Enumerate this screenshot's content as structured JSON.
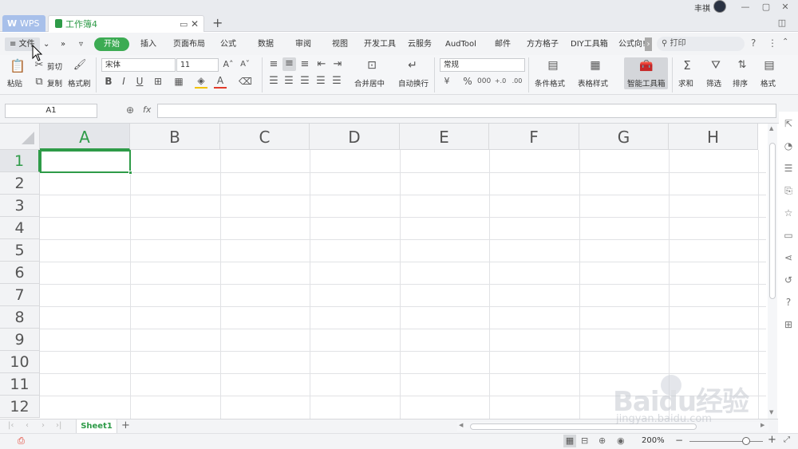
{
  "titlebar": {
    "user_name": "丰祺",
    "tabs": [
      {
        "label": "WPS"
      },
      {
        "label": "工作簿4"
      }
    ],
    "new_tab": "+"
  },
  "menubar": {
    "file_label": "文件",
    "items": [
      "开始",
      "插入",
      "页面布局",
      "公式",
      "数据",
      "审阅",
      "视图",
      "开发工具",
      "云服务",
      "AudTool",
      "邮件",
      "方方格子",
      "DIY工具箱",
      "公式向!"
    ],
    "search_placeholder": "打印",
    "help": "?"
  },
  "ribbon": {
    "paste": "粘贴",
    "cut": "剪切",
    "copy": "复制",
    "format_painter": "格式刷",
    "font_name": "宋体",
    "font_size": "11",
    "bold": "B",
    "italic": "I",
    "underline": "U",
    "merge_center": "合并居中",
    "wrap_text": "自动换行",
    "number_format": "常规",
    "conditional_format": "条件格式",
    "table_style": "表格样式",
    "smart_toolbox": "智能工具箱",
    "sum": "求和",
    "filter": "筛选",
    "sort": "排序",
    "format": "格式",
    "percent": "%"
  },
  "formulabar": {
    "name_box": "A1",
    "fx": "fx",
    "value": ""
  },
  "sheet": {
    "columns": [
      "A",
      "B",
      "C",
      "D",
      "E",
      "F",
      "G",
      "H"
    ],
    "rows": [
      "1",
      "2",
      "3",
      "4",
      "5",
      "6",
      "7",
      "8",
      "9",
      "10",
      "11",
      "12"
    ],
    "active_cell": "A1",
    "accent_color": "#2e9b48"
  },
  "sheet_tabs": {
    "active": "Sheet1",
    "add": "+"
  },
  "statusbar": {
    "zoom": "200%",
    "minus": "−",
    "plus": "+"
  },
  "watermark": {
    "brand": "Baidu经验",
    "url": "jingyan.baidu.com"
  }
}
